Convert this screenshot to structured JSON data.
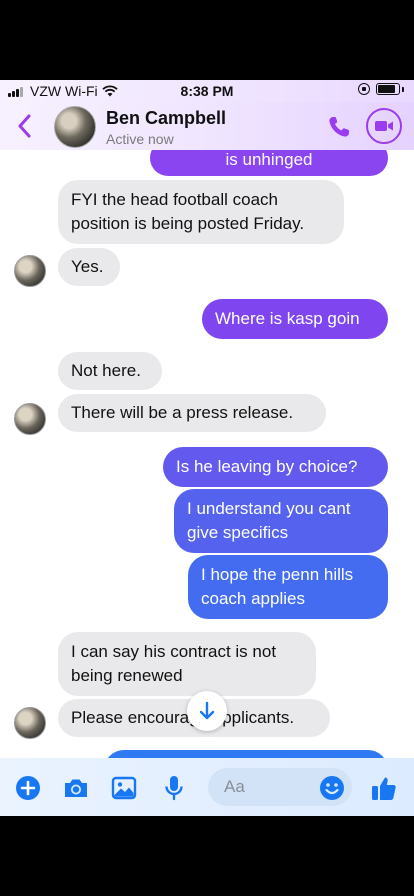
{
  "status_bar": {
    "carrier": "VZW Wi-Fi",
    "time": "8:38 PM"
  },
  "header": {
    "contact_name": "Ben Campbell",
    "presence": "Active now",
    "accent_color": "#9b3cf0"
  },
  "messages": [
    {
      "sender": "me",
      "text": "is unhinged"
    },
    {
      "sender": "them",
      "text": "FYI the head football coach position is being posted Friday."
    },
    {
      "sender": "them",
      "text": "Yes."
    },
    {
      "sender": "me",
      "text": "Where is kasp goin"
    },
    {
      "sender": "them",
      "text": "Not here."
    },
    {
      "sender": "them",
      "text": "There will be a press release."
    },
    {
      "sender": "me",
      "text": "Is he leaving by choice?"
    },
    {
      "sender": "me",
      "text": "I understand you cant give specifics"
    },
    {
      "sender": "me",
      "text": "I hope the penn hills coach applies"
    },
    {
      "sender": "them",
      "text": "I can say his contract is not being renewed"
    },
    {
      "sender": "them",
      "text": "Please encourage applicants."
    }
  ],
  "composer": {
    "placeholder": "Aa",
    "icons": [
      "plus-icon",
      "camera-icon",
      "image-icon",
      "microphone-icon",
      "emoji-icon",
      "thumbs-up-icon"
    ],
    "icon_color": "#1877f2"
  }
}
